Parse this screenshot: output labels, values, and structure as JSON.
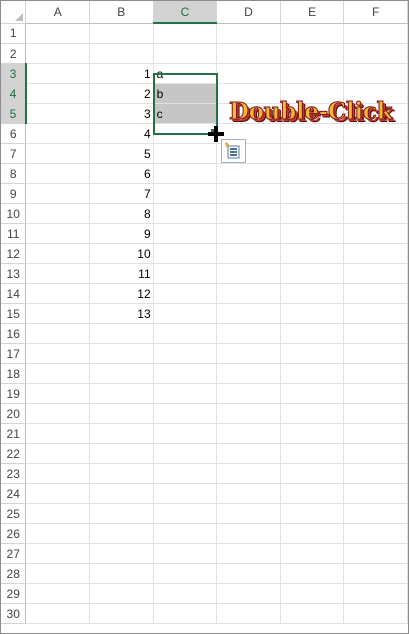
{
  "columns": [
    "A",
    "B",
    "C",
    "D",
    "E",
    "F"
  ],
  "selected_column": "C",
  "rows": [
    "1",
    "2",
    "3",
    "4",
    "5",
    "6",
    "7",
    "8",
    "9",
    "10",
    "11",
    "12",
    "13",
    "14",
    "15",
    "16",
    "17",
    "18",
    "19",
    "20",
    "21",
    "22",
    "23",
    "24",
    "25",
    "26",
    "27",
    "28",
    "29",
    "30"
  ],
  "selected_rows": [
    "3",
    "4",
    "5"
  ],
  "column_b_values": [
    "",
    "",
    "1",
    "2",
    "3",
    "4",
    "5",
    "6",
    "7",
    "8",
    "9",
    "10",
    "11",
    "12",
    "13"
  ],
  "column_c_values": [
    "",
    "",
    "a",
    "b",
    "c"
  ],
  "overlay": {
    "label": "Double-Click",
    "cursor_icon": "fill-crosshair-icon",
    "autofill_icon": "auto-fill-options-icon"
  },
  "colors": {
    "selection_border": "#217346",
    "selection_fill": "#c6c6c6",
    "label_fill": "#f3b73a",
    "label_outline": "#7a1313"
  }
}
